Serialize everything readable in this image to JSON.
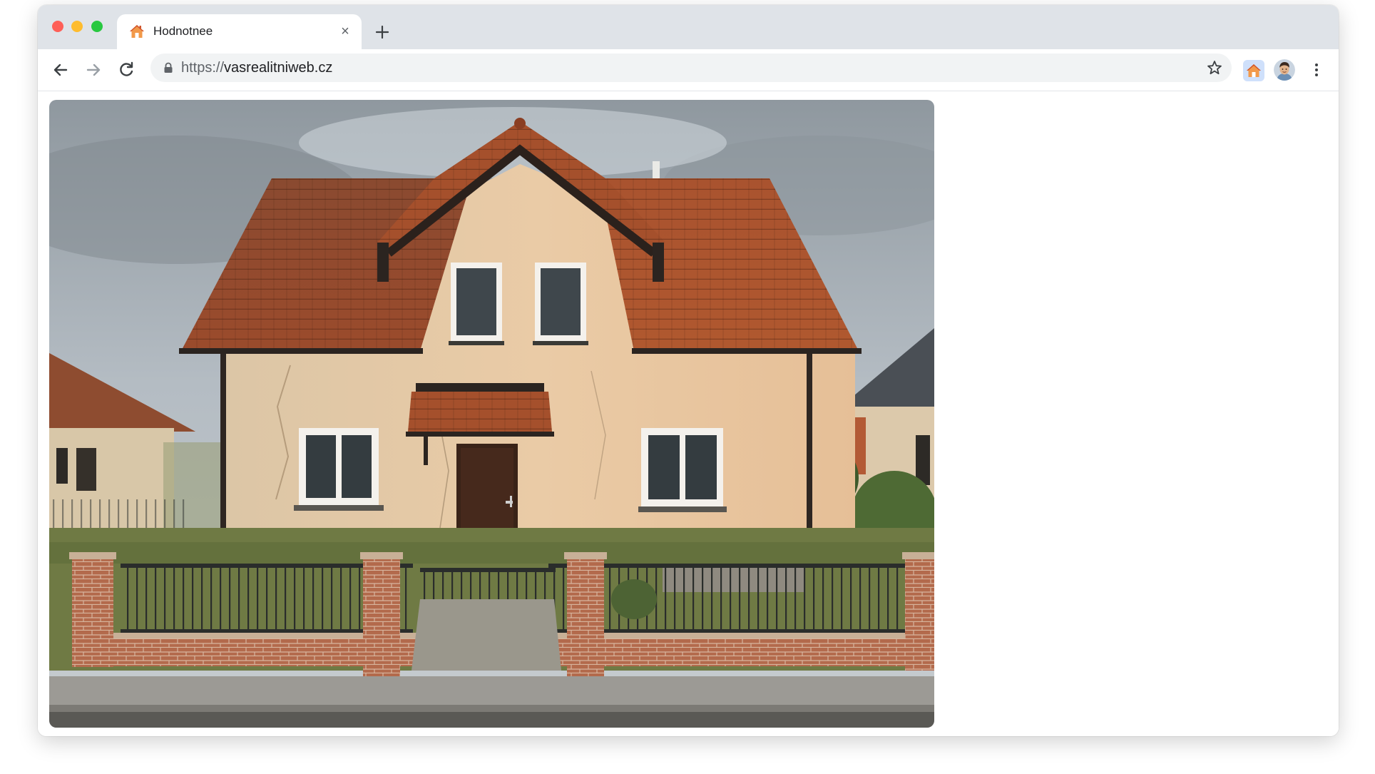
{
  "browser": {
    "tab": {
      "title": "Hodnotnee",
      "favicon": "house-icon",
      "close_glyph": "×"
    },
    "new_tab_icon": "plus-icon",
    "nav": {
      "back_icon": "arrow-left-icon",
      "forward_icon": "arrow-right-icon",
      "reload_icon": "reload-icon"
    },
    "address_bar": {
      "scheme": "https://",
      "host": "vasrealitniweb.cz",
      "lock_icon": "lock-icon",
      "bookmark_icon": "star-icon"
    },
    "extension_icon": "house-extension-icon",
    "profile_icon": "avatar-icon",
    "menu_icon": "kebab-menu-icon"
  },
  "page": {
    "image": {
      "subject": "house-photo",
      "colors": {
        "wall": "#e8c9a4",
        "roof": "#9e4a2a",
        "sky": "#aab2ba",
        "grass": "#6d7a3e",
        "brick": "#b0654a"
      }
    }
  },
  "colors": {
    "tabbar": "#dfe3e8",
    "omnibox": "#f1f3f4",
    "close_red": "#fe5f57",
    "minimize_yellow": "#febc2e",
    "maximize_green": "#28c840"
  }
}
